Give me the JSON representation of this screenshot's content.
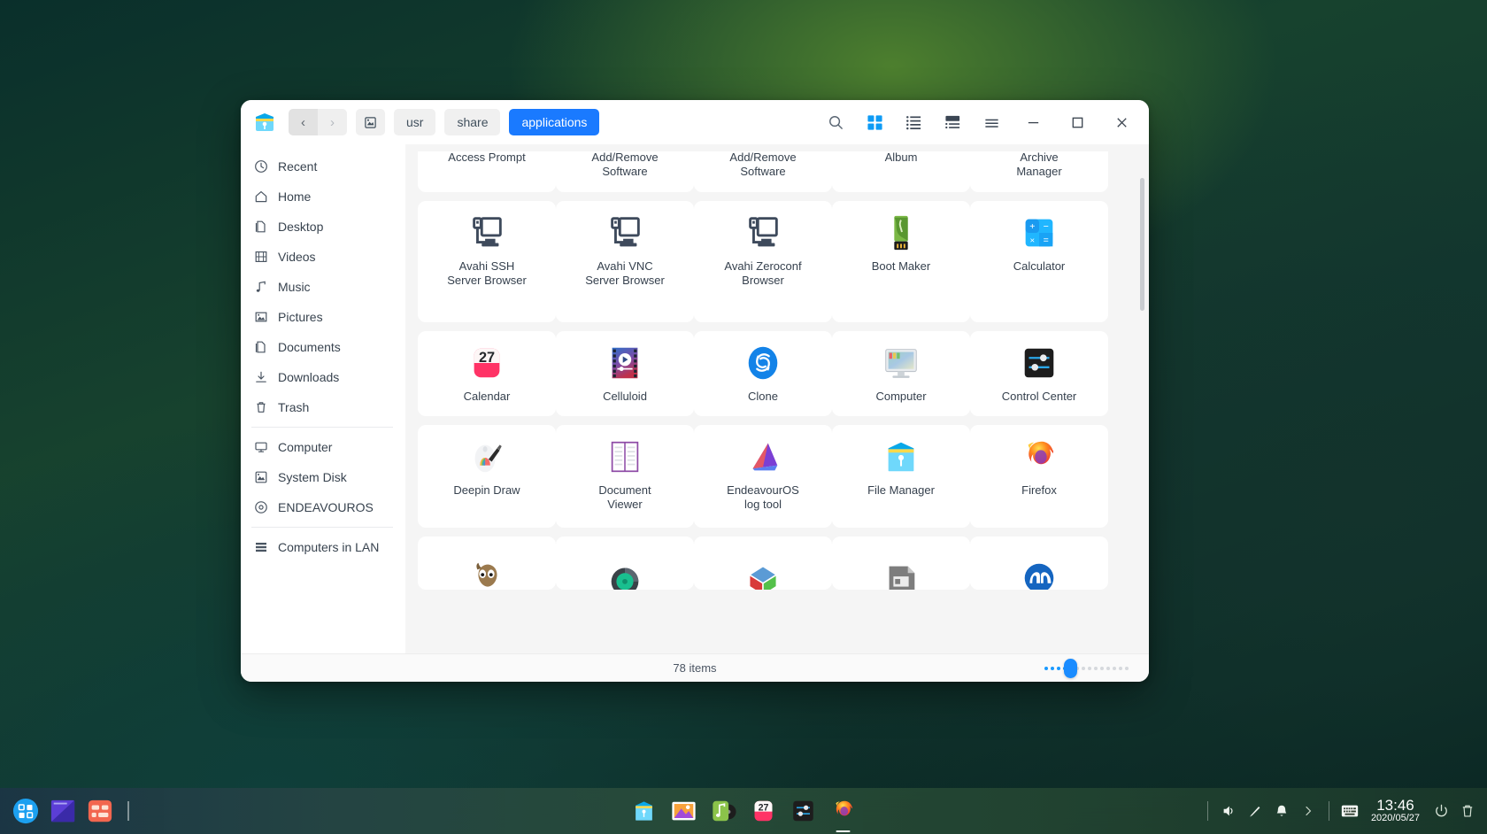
{
  "window": {
    "app_icon": "file-manager-icon",
    "nav": {
      "back": "‹",
      "forward": "›"
    },
    "breadcrumbs": [
      {
        "label": "",
        "icon": "system-disk-icon",
        "active": false
      },
      {
        "label": "usr",
        "active": false
      },
      {
        "label": "share",
        "active": false
      },
      {
        "label": "applications",
        "active": true
      }
    ],
    "toolbar": [
      {
        "name": "search-icon",
        "label": "Search",
        "active": false
      },
      {
        "name": "grid-view-icon",
        "label": "Icon view",
        "active": true
      },
      {
        "name": "list-view-icon",
        "label": "List view",
        "active": false
      },
      {
        "name": "extended-view-icon",
        "label": "Extended view",
        "active": false
      },
      {
        "name": "menu-icon",
        "label": "Menu",
        "active": false
      }
    ],
    "controls": [
      {
        "name": "minimize-button",
        "label": "Minimize"
      },
      {
        "name": "maximize-button",
        "label": "Maximize"
      },
      {
        "name": "close-button",
        "label": "Close"
      }
    ]
  },
  "sidebar": {
    "groups": [
      {
        "items": [
          {
            "label": "Recent",
            "icon": "clock-icon"
          },
          {
            "label": "Home",
            "icon": "home-icon"
          },
          {
            "label": "Desktop",
            "icon": "desktop-icon"
          },
          {
            "label": "Videos",
            "icon": "video-icon"
          },
          {
            "label": "Music",
            "icon": "music-note-icon"
          },
          {
            "label": "Pictures",
            "icon": "picture-icon"
          },
          {
            "label": "Documents",
            "icon": "document-icon"
          },
          {
            "label": "Downloads",
            "icon": "download-icon"
          },
          {
            "label": "Trash",
            "icon": "trash-icon"
          }
        ]
      },
      {
        "items": [
          {
            "label": "Computer",
            "icon": "monitor-icon"
          },
          {
            "label": "System Disk",
            "icon": "disk-icon"
          },
          {
            "label": "ENDEAVOUROS",
            "icon": "optical-disc-icon"
          }
        ]
      },
      {
        "items": [
          {
            "label": "Computers in LAN",
            "icon": "network-icon"
          }
        ]
      }
    ]
  },
  "file_grid": {
    "rows": [
      {
        "clipped_top": true,
        "items": [
          {
            "label": "Access Prompt",
            "label2": "",
            "icon": "access-prompt-icon"
          },
          {
            "label": "Add/Remove",
            "label2": "Software",
            "icon": "add-remove-software-icon"
          },
          {
            "label": "Add/Remove",
            "label2": "Software",
            "icon": "add-remove-software-icon"
          },
          {
            "label": "Album",
            "label2": "",
            "icon": "album-icon"
          },
          {
            "label": "Archive",
            "label2": "Manager",
            "icon": "archive-manager-icon"
          }
        ]
      },
      {
        "clipped_top": false,
        "items": [
          {
            "label": "Avahi SSH",
            "label2": "Server Browser",
            "icon": "avahi-ssh-icon"
          },
          {
            "label": "Avahi VNC",
            "label2": "Server Browser",
            "icon": "avahi-vnc-icon"
          },
          {
            "label": "Avahi Zeroconf",
            "label2": "Browser",
            "icon": "avahi-zeroconf-icon"
          },
          {
            "label": "Boot Maker",
            "label2": "",
            "icon": "boot-maker-icon"
          },
          {
            "label": "Calculator",
            "label2": "",
            "icon": "calculator-icon"
          }
        ]
      },
      {
        "clipped_top": false,
        "items": [
          {
            "label": "Calendar",
            "label2": "",
            "icon": "calendar-icon"
          },
          {
            "label": "Celluloid",
            "label2": "",
            "icon": "celluloid-icon"
          },
          {
            "label": "Clone",
            "label2": "",
            "icon": "clone-icon"
          },
          {
            "label": "Computer",
            "label2": "",
            "icon": "computer-icon"
          },
          {
            "label": "Control Center",
            "label2": "",
            "icon": "control-center-icon"
          }
        ]
      },
      {
        "clipped_top": false,
        "items": [
          {
            "label": "Deepin Draw",
            "label2": "",
            "icon": "deepin-draw-icon"
          },
          {
            "label": "Document",
            "label2": "Viewer",
            "icon": "document-viewer-icon"
          },
          {
            "label": "EndeavourOS",
            "label2": "log tool",
            "icon": "endeavouros-log-icon"
          },
          {
            "label": "File Manager",
            "label2": "",
            "icon": "file-manager-icon"
          },
          {
            "label": "Firefox",
            "label2": "",
            "icon": "firefox-icon"
          }
        ]
      },
      {
        "clipped_top": false,
        "clipped_bottom": true,
        "items": [
          {
            "label": "",
            "label2": "",
            "icon": "gimp-icon"
          },
          {
            "label": "",
            "label2": "",
            "icon": "gnome-disks-icon"
          },
          {
            "label": "",
            "label2": "",
            "icon": "gnome-boxes-icon"
          },
          {
            "label": "",
            "label2": "",
            "icon": "gparted-icon"
          },
          {
            "label": "",
            "label2": "",
            "icon": "htop-icon"
          }
        ]
      }
    ]
  },
  "statusbar": {
    "item_count": "78 items",
    "zoom_level": 2
  },
  "dock": {
    "left": [
      {
        "name": "launcher-icon",
        "label": "Launcher"
      },
      {
        "name": "show-desktop-icon",
        "label": "Show Desktop"
      },
      {
        "name": "app-grid-icon",
        "label": "Applications"
      }
    ],
    "center": [
      {
        "name": "file-manager-icon",
        "label": "File Manager",
        "running": false
      },
      {
        "name": "image-viewer-icon",
        "label": "Image Viewer",
        "running": false
      },
      {
        "name": "music-player-icon",
        "label": "Music",
        "running": false
      },
      {
        "name": "calendar-icon",
        "label": "Calendar",
        "running": false,
        "day": "27"
      },
      {
        "name": "control-center-icon",
        "label": "Control Center",
        "running": false
      },
      {
        "name": "firefox-icon",
        "label": "Firefox",
        "running": true
      }
    ],
    "tray": [
      {
        "name": "volume-icon",
        "label": "Volume"
      },
      {
        "name": "brightness-icon",
        "label": "Brightness"
      },
      {
        "name": "notification-bell-icon",
        "label": "Notifications"
      },
      {
        "name": "tray-expand-icon",
        "label": "Show more"
      }
    ],
    "keyboard": {
      "name": "keyboard-layout-icon",
      "label": "Keyboard"
    },
    "clock": {
      "time": "13:46",
      "date": "2020/05/27"
    },
    "power": {
      "name": "power-icon",
      "label": "Power"
    },
    "trash": {
      "name": "trash-icon",
      "label": "Trash"
    }
  },
  "colors": {
    "accent": "#1a7aff",
    "accent_light": "#1a9aff",
    "window_bg": "#f5f5f5",
    "tile_bg": "#ffffff",
    "text": "#36414e"
  }
}
